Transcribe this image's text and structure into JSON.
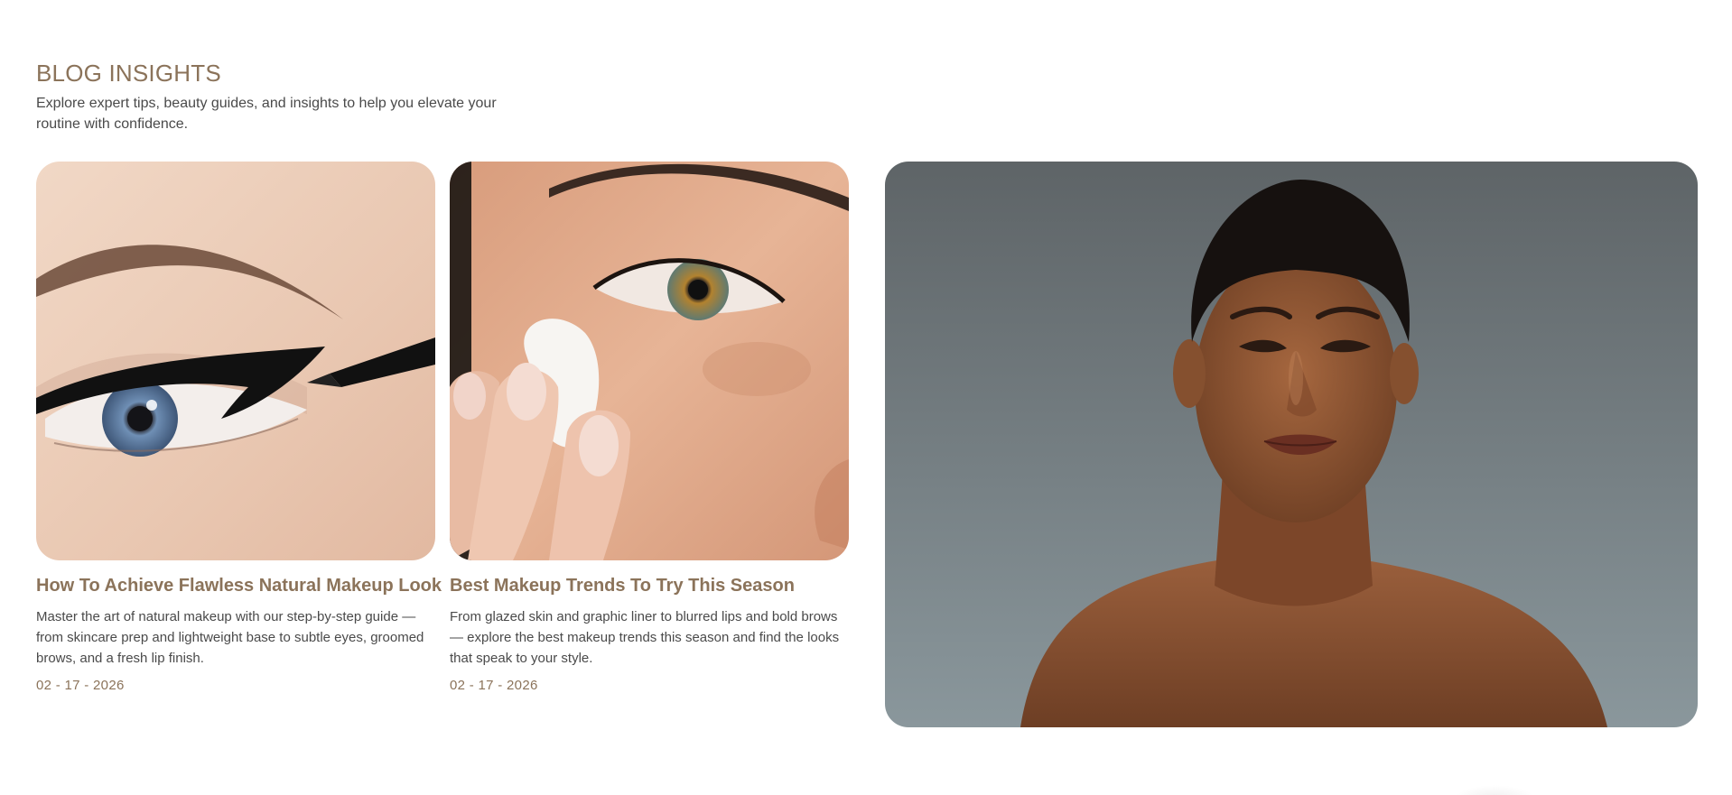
{
  "section": {
    "heading": "BLOG INSIGHTS",
    "subtitle": "Explore expert tips, beauty guides, and insights to help you elevate your routine with confidence."
  },
  "posts": [
    {
      "title": "How To Achieve Flawless Natural Makeup Look",
      "excerpt": "Master the art of natural makeup with our step-by-step guide — from skincare prep and lightweight base to subtle eyes, groomed brows, and a fresh lip finish.",
      "date": "02 - 17 - 2026",
      "image": "eyeliner-closeup-photo"
    },
    {
      "title": "Best Makeup Trends To Try This Season",
      "excerpt": "From glazed skin and graphic liner to blurred lips and bold brows — explore the best makeup trends this season and find the looks that speak to your style.",
      "date": "02 - 17 - 2026",
      "image": "skin-cream-application-photo"
    }
  ],
  "feature": {
    "image": "portrait-model-photo"
  },
  "colors": {
    "accent": "#8b735a",
    "body_text": "#4a4a4a",
    "background": "#ffffff"
  }
}
